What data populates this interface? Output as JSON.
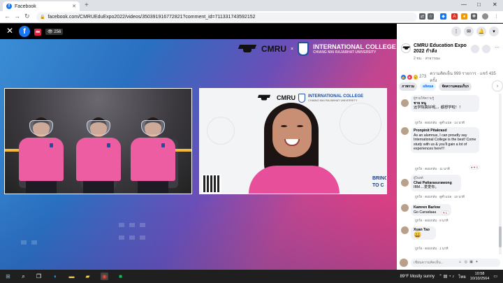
{
  "browser": {
    "tab_title": "Facebook",
    "url": "facebook.com/CMRUEduExpo2022/videos/350391916772821?comment_id=711331743592152",
    "new_tab": "+",
    "minimize": "—",
    "maximize": "□",
    "close": "✕"
  },
  "video": {
    "close": "✕",
    "fb_logo": "f",
    "live_badge": "สด",
    "viewers": "256",
    "brand_cmru": "CMRU",
    "brand_x": "×",
    "brand_ic_line1": "INTERNATIONAL COLLEGE",
    "brand_ic_line2": "CHIANG MAI RAJABHAT UNIVERSITY",
    "right_ic_line1": "INTERNATIONAL COLLEGE",
    "right_ic_line2": "CHIANG MAI RAJABHAT UNIVERSITY",
    "bring": "BRING TO C",
    "colors": {
      "pink": "#e33c7d",
      "blue": "#2a6fc0"
    }
  },
  "sidebar": {
    "page_name": "CMRU Education Expo 2022 กำลัง",
    "page_time": "2 ชม. · สาธารณะ",
    "reaction_count": "273",
    "stats_text": "ความคิดเห็น 999 รายการ · แชร์ 435 ครั้ง",
    "tabs": [
      {
        "label": "ภาพรวม"
      },
      {
        "label": "ผลิตผล"
      },
      {
        "label": "จัดความคอมเก็บร"
      }
    ],
    "comments": [
      {
        "top": "ผู้ร่วมให้ความรู้",
        "name": "ชาย หนู",
        "text": "远学院真好呢。，都想学啦！！",
        "actions": "ถูกใจ · ตอบกลับ · ดูคำแปล · 14 นาที"
      },
      {
        "name": "Pronpinit Pitakrasd",
        "text": "As an alumnus, I can proudly say International College is the best! Come study with us & you'll gain a lot of experiences here!!!",
        "actions": "ถูกใจ · ตอบกลับ · 11 นาที",
        "react": "4"
      },
      {
        "top": "ผู้โพสต์",
        "name": "Chai Pattarasurawong",
        "text": "IBM....爱爱你。",
        "actions": "ถูกใจ · ตอบกลับ · ดูคำแปล · 10 นาที"
      },
      {
        "name": "Kamren Barlow",
        "text": "Go Canadaaa",
        "actions": "ถูกใจ · ตอบกลับ · 9 นาที",
        "react": "1"
      },
      {
        "name": "Xuan Tao",
        "text": "😄",
        "actions": "ถูกใจ · ตอบกลับ · 1 นาที"
      }
    ],
    "comment_placeholder": "เขียนความคิดเห็น...",
    "comment_icons": "☺ ◎ ▣ ✦"
  },
  "taskbar": {
    "weather": "89°F  Mostly sunny",
    "lang": "ไทย",
    "time": "10:58",
    "date": "10/10/2564"
  }
}
